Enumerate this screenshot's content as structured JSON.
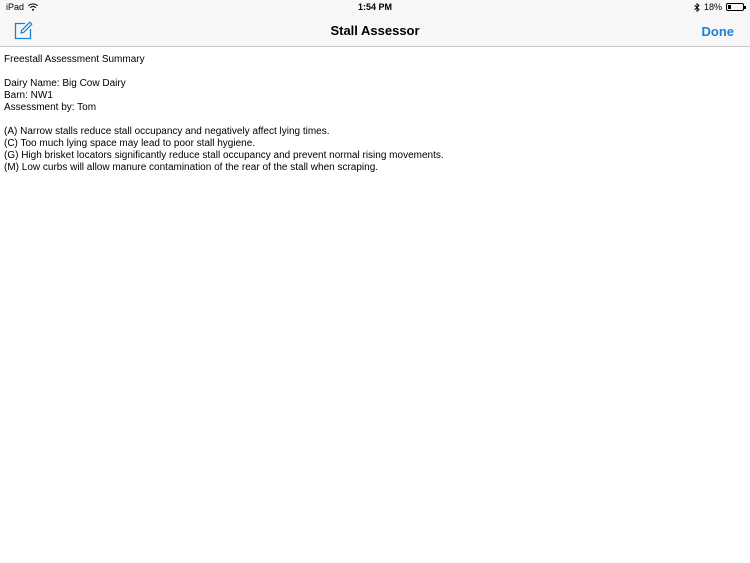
{
  "status_bar": {
    "device": "iPad",
    "time": "1:54 PM",
    "battery_text": "18%",
    "battery_level": 0.18
  },
  "nav": {
    "title": "Stall Assessor",
    "done_label": "Done",
    "compose_icon": "compose-icon"
  },
  "summary": {
    "heading": "Freestall Assessment Summary",
    "dairy_name": "Dairy Name: Big Cow Dairy",
    "barn": "Barn: NW1",
    "assessed_by": "Assessment by: Tom",
    "findings": [
      "(A) Narrow stalls reduce stall occupancy and negatively affect lying times.",
      "(C) Too much lying space may lead to poor stall hygiene.",
      "(G) High brisket locators significantly reduce stall occupancy and prevent normal rising movements.",
      "(M) Low curbs will allow manure contamination of the rear of the stall when scraping."
    ]
  },
  "colors": {
    "accent": "#1b7fd6",
    "bar_bg": "#f7f7f7"
  }
}
